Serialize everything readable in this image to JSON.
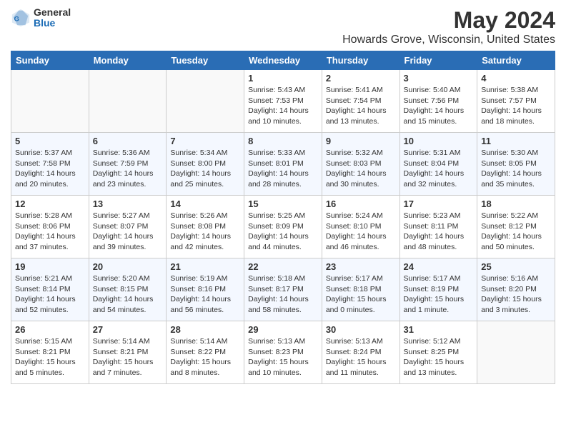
{
  "header": {
    "logo_general": "General",
    "logo_blue": "Blue",
    "month_year": "May 2024",
    "location": "Howards Grove, Wisconsin, United States"
  },
  "days_of_week": [
    "Sunday",
    "Monday",
    "Tuesday",
    "Wednesday",
    "Thursday",
    "Friday",
    "Saturday"
  ],
  "weeks": [
    [
      {
        "day": "",
        "info": ""
      },
      {
        "day": "",
        "info": ""
      },
      {
        "day": "",
        "info": ""
      },
      {
        "day": "1",
        "info": "Sunrise: 5:43 AM\nSunset: 7:53 PM\nDaylight: 14 hours\nand 10 minutes."
      },
      {
        "day": "2",
        "info": "Sunrise: 5:41 AM\nSunset: 7:54 PM\nDaylight: 14 hours\nand 13 minutes."
      },
      {
        "day": "3",
        "info": "Sunrise: 5:40 AM\nSunset: 7:56 PM\nDaylight: 14 hours\nand 15 minutes."
      },
      {
        "day": "4",
        "info": "Sunrise: 5:38 AM\nSunset: 7:57 PM\nDaylight: 14 hours\nand 18 minutes."
      }
    ],
    [
      {
        "day": "5",
        "info": "Sunrise: 5:37 AM\nSunset: 7:58 PM\nDaylight: 14 hours\nand 20 minutes."
      },
      {
        "day": "6",
        "info": "Sunrise: 5:36 AM\nSunset: 7:59 PM\nDaylight: 14 hours\nand 23 minutes."
      },
      {
        "day": "7",
        "info": "Sunrise: 5:34 AM\nSunset: 8:00 PM\nDaylight: 14 hours\nand 25 minutes."
      },
      {
        "day": "8",
        "info": "Sunrise: 5:33 AM\nSunset: 8:01 PM\nDaylight: 14 hours\nand 28 minutes."
      },
      {
        "day": "9",
        "info": "Sunrise: 5:32 AM\nSunset: 8:03 PM\nDaylight: 14 hours\nand 30 minutes."
      },
      {
        "day": "10",
        "info": "Sunrise: 5:31 AM\nSunset: 8:04 PM\nDaylight: 14 hours\nand 32 minutes."
      },
      {
        "day": "11",
        "info": "Sunrise: 5:30 AM\nSunset: 8:05 PM\nDaylight: 14 hours\nand 35 minutes."
      }
    ],
    [
      {
        "day": "12",
        "info": "Sunrise: 5:28 AM\nSunset: 8:06 PM\nDaylight: 14 hours\nand 37 minutes."
      },
      {
        "day": "13",
        "info": "Sunrise: 5:27 AM\nSunset: 8:07 PM\nDaylight: 14 hours\nand 39 minutes."
      },
      {
        "day": "14",
        "info": "Sunrise: 5:26 AM\nSunset: 8:08 PM\nDaylight: 14 hours\nand 42 minutes."
      },
      {
        "day": "15",
        "info": "Sunrise: 5:25 AM\nSunset: 8:09 PM\nDaylight: 14 hours\nand 44 minutes."
      },
      {
        "day": "16",
        "info": "Sunrise: 5:24 AM\nSunset: 8:10 PM\nDaylight: 14 hours\nand 46 minutes."
      },
      {
        "day": "17",
        "info": "Sunrise: 5:23 AM\nSunset: 8:11 PM\nDaylight: 14 hours\nand 48 minutes."
      },
      {
        "day": "18",
        "info": "Sunrise: 5:22 AM\nSunset: 8:12 PM\nDaylight: 14 hours\nand 50 minutes."
      }
    ],
    [
      {
        "day": "19",
        "info": "Sunrise: 5:21 AM\nSunset: 8:14 PM\nDaylight: 14 hours\nand 52 minutes."
      },
      {
        "day": "20",
        "info": "Sunrise: 5:20 AM\nSunset: 8:15 PM\nDaylight: 14 hours\nand 54 minutes."
      },
      {
        "day": "21",
        "info": "Sunrise: 5:19 AM\nSunset: 8:16 PM\nDaylight: 14 hours\nand 56 minutes."
      },
      {
        "day": "22",
        "info": "Sunrise: 5:18 AM\nSunset: 8:17 PM\nDaylight: 14 hours\nand 58 minutes."
      },
      {
        "day": "23",
        "info": "Sunrise: 5:17 AM\nSunset: 8:18 PM\nDaylight: 15 hours\nand 0 minutes."
      },
      {
        "day": "24",
        "info": "Sunrise: 5:17 AM\nSunset: 8:19 PM\nDaylight: 15 hours\nand 1 minute."
      },
      {
        "day": "25",
        "info": "Sunrise: 5:16 AM\nSunset: 8:20 PM\nDaylight: 15 hours\nand 3 minutes."
      }
    ],
    [
      {
        "day": "26",
        "info": "Sunrise: 5:15 AM\nSunset: 8:21 PM\nDaylight: 15 hours\nand 5 minutes."
      },
      {
        "day": "27",
        "info": "Sunrise: 5:14 AM\nSunset: 8:21 PM\nDaylight: 15 hours\nand 7 minutes."
      },
      {
        "day": "28",
        "info": "Sunrise: 5:14 AM\nSunset: 8:22 PM\nDaylight: 15 hours\nand 8 minutes."
      },
      {
        "day": "29",
        "info": "Sunrise: 5:13 AM\nSunset: 8:23 PM\nDaylight: 15 hours\nand 10 minutes."
      },
      {
        "day": "30",
        "info": "Sunrise: 5:13 AM\nSunset: 8:24 PM\nDaylight: 15 hours\nand 11 minutes."
      },
      {
        "day": "31",
        "info": "Sunrise: 5:12 AM\nSunset: 8:25 PM\nDaylight: 15 hours\nand 13 minutes."
      },
      {
        "day": "",
        "info": ""
      }
    ]
  ]
}
